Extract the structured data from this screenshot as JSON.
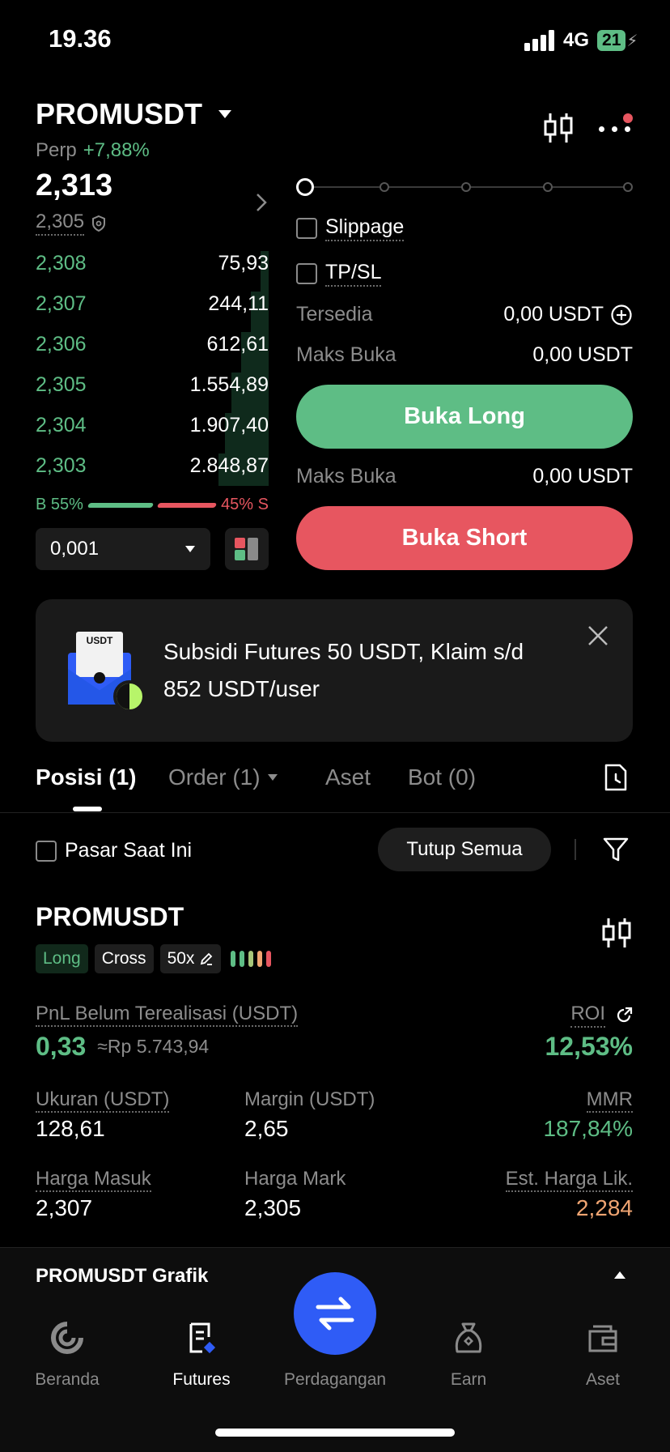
{
  "status_bar": {
    "time": "19.36",
    "network": "4G",
    "battery": "21"
  },
  "header": {
    "symbol": "PROMUSDT",
    "type": "Perp",
    "change": "+7,88%"
  },
  "price": {
    "last": "2,313",
    "mark": "2,305"
  },
  "orderbook": {
    "rows": [
      {
        "price": "2,308",
        "qty": "75,93"
      },
      {
        "price": "2,307",
        "qty": "244,11"
      },
      {
        "price": "2,306",
        "qty": "612,61"
      },
      {
        "price": "2,305",
        "qty": "1.554,89"
      },
      {
        "price": "2,304",
        "qty": "1.907,40"
      },
      {
        "price": "2,303",
        "qty": "2.848,87"
      }
    ],
    "buy_ratio": "B 55%",
    "sell_ratio": "45% S",
    "buy_fraction": 0.55,
    "precision": "0,001"
  },
  "trade": {
    "slippage": "Slippage",
    "tpsl": "TP/SL",
    "available_label": "Tersedia",
    "available_value": "0,00 USDT",
    "max_open_label": "Maks Buka",
    "max_open_long": "0,00 USDT",
    "max_open_short": "0,00 USDT",
    "buy_long": "Buka Long",
    "buy_short": "Buka Short"
  },
  "banner": {
    "badge": "USDT",
    "line1": "Subsidi Futures 50 USDT, Klaim s/d",
    "line2": "852 USDT/user"
  },
  "tabs": {
    "positions": "Posisi (1)",
    "orders": "Order (1)",
    "assets": "Aset",
    "bots": "Bot (0)"
  },
  "filter": {
    "current_market": "Pasar Saat Ini",
    "close_all": "Tutup Semua"
  },
  "position": {
    "symbol": "PROMUSDT",
    "side": "Long",
    "margin_mode": "Cross",
    "leverage": "50x",
    "pnl_label": "PnL Belum Terealisasi (USDT)",
    "pnl_value": "0,33",
    "pnl_idr": "≈Rp 5.743,94",
    "roi_label": "ROI",
    "roi_value": "12,53%",
    "size_label": "Ukuran (USDT)",
    "size_value": "128,61",
    "margin_label": "Margin (USDT)",
    "margin_value": "2,65",
    "mmr_label": "MMR",
    "mmr_value": "187,84%",
    "entry_label": "Harga Masuk",
    "entry_value": "2,307",
    "mark_label": "Harga Mark",
    "mark_value": "2,305",
    "liq_label": "Est. Harga Lik.",
    "liq_value": "2,284"
  },
  "chart_bar": {
    "title": "PROMUSDT Grafik"
  },
  "bottom_nav": {
    "home": "Beranda",
    "futures": "Futures",
    "trade": "Perdagangan",
    "earn": "Earn",
    "assets": "Aset"
  },
  "colors": {
    "green": "#5ebd85",
    "red": "#e75660",
    "blue": "#2f5cf6",
    "orange": "#f0a572"
  }
}
